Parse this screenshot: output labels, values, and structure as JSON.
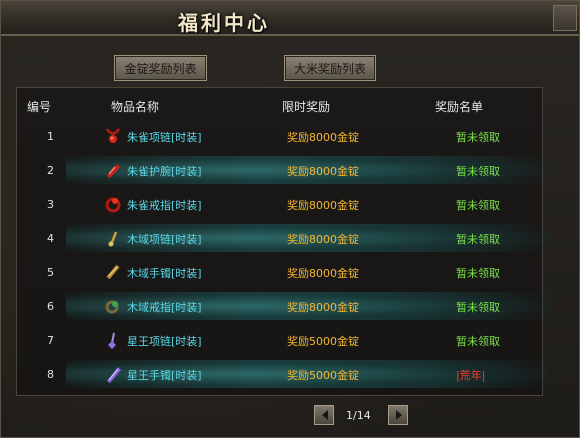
{
  "window": {
    "title": "福利中心"
  },
  "tabs": [
    {
      "label": "金锭奖励列表"
    },
    {
      "label": "大米奖励列表"
    }
  ],
  "table": {
    "headers": [
      "编号",
      "物品名称",
      "限时奖励",
      "奖励名单"
    ],
    "rows": [
      {
        "num": "1",
        "name": "朱雀项链[时装]",
        "reward": "奖励8000金锭",
        "status": "暂未领取",
        "icon": "red-necklace-icon"
      },
      {
        "num": "2",
        "name": "朱雀护腕[时装]",
        "reward": "奖励8000金锭",
        "status": "暂未领取",
        "icon": "red-bracelet-icon"
      },
      {
        "num": "3",
        "name": "朱雀戒指[时装]",
        "reward": "奖励8000金锭",
        "status": "暂未领取",
        "icon": "red-ring-icon"
      },
      {
        "num": "4",
        "name": "木域项链[时装]",
        "reward": "奖励8000金锭",
        "status": "暂未领取",
        "icon": "gold-necklace-icon"
      },
      {
        "num": "5",
        "name": "木域手镯[时装]",
        "reward": "奖励8000金锭",
        "status": "暂未领取",
        "icon": "gold-bracelet-icon"
      },
      {
        "num": "6",
        "name": "木域戒指[时装]",
        "reward": "奖励8000金锭",
        "status": "暂未领取",
        "icon": "green-ring-icon"
      },
      {
        "num": "7",
        "name": "星王项链[时装]",
        "reward": "奖励5000金锭",
        "status": "暂未领取",
        "icon": "purple-necklace-icon"
      },
      {
        "num": "8",
        "name": "星王手镯[时装]",
        "reward": "奖励5000金锭",
        "status": "|荒年|",
        "icon": "purple-bracelet-icon"
      }
    ]
  },
  "pagination": {
    "label": "1/14"
  },
  "colors": {
    "item_name": "#5ad8e6",
    "reward": "#f2b632",
    "status_unclaimed": "#7be24a",
    "status_claimed": "#ff3a2a"
  }
}
